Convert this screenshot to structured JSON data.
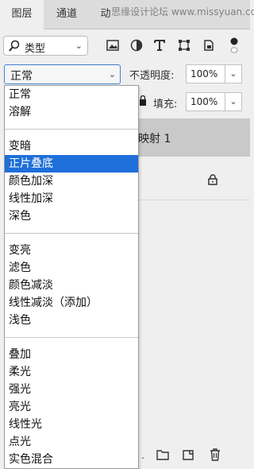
{
  "tabs": [
    {
      "label": "图层"
    },
    {
      "label": "通道"
    },
    {
      "label": "动"
    }
  ],
  "watermark": "思缘设计论坛 www.missyuan.com",
  "filter": {
    "label": "类型"
  },
  "blend": {
    "current": "正常",
    "opacity_label": "不透明度:",
    "opacity_value": "100%",
    "fill_label": "填充:",
    "fill_value": "100%"
  },
  "layers": {
    "selected_name": "映射 1"
  },
  "menu": {
    "groups": [
      [
        "正常",
        "溶解"
      ],
      [
        "变暗",
        "正片叠底",
        "颜色加深",
        "线性加深",
        "深色"
      ],
      [
        "变亮",
        "滤色",
        "颜色减淡",
        "线性减淡（添加）",
        "浅色"
      ],
      [
        "叠加",
        "柔光",
        "强光",
        "亮光",
        "线性光",
        "点光",
        "实色混合"
      ]
    ],
    "selected": "正片叠底"
  },
  "colors": {
    "accent": "#1e6fd9",
    "panel": "#efefef"
  }
}
